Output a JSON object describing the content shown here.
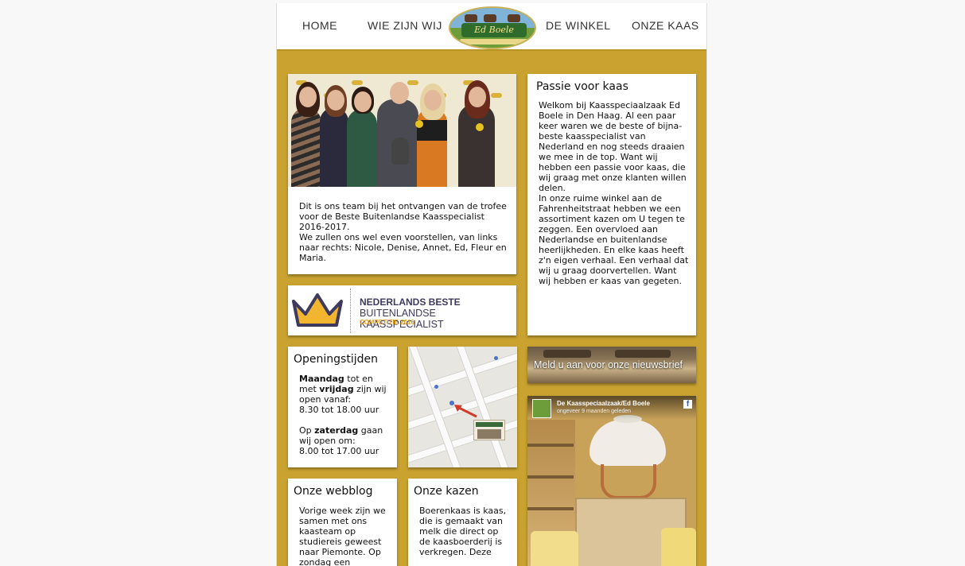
{
  "nav": {
    "home": "HOME",
    "about": "WIE ZIJN WIJ",
    "shop": "DE WINKEL",
    "cheese": "ONZE KAAS",
    "logo_text": "Ed Boele"
  },
  "team": {
    "caption_line1": "Dit is ons team bij het ontvangen van de trofee voor de Beste Buitenlandse Kaasspecialist 2016-2017.",
    "caption_line2": "We zullen ons wel even voorstellen, van links naar rechts: Nicole, Denise, Annet, Ed, Fleur en Maria."
  },
  "award": {
    "line1": "NEDERLANDS BESTE",
    "line2": "BUITENLANDSE KAASSPECIALIST",
    "line3": "COMPETITIE 2016"
  },
  "passie": {
    "title": "Passie voor kaas",
    "para1": "Welkom bij Kaasspeciaalzaak Ed Boele in Den Haag. Al een paar keer waren we de beste of bijna-beste kaasspecialist van Nederland en nog steeds draaien we mee in de top. Want wij hebben een passie voor kaas, die wij graag met onze klanten willen delen.",
    "para2": "In onze ruime winkel aan de Fahrenheitstraat hebben we een assortiment kazen om U tegen te zeggen. Een overvloed aan Nederlandse en buitenlandse heerlijkheden. En elke kaas heeft z'n eigen verhaal. Een verhaal dat wij u graag doorvertellen. Want wij hebben er kaas van gegeten."
  },
  "hours": {
    "title": "Openingstijden",
    "weekday_1": "Maandag",
    "weekday_2": " tot en met ",
    "weekday_3": "vrijdag",
    "weekday_4": " zijn wij open vanaf:",
    "weekday_time": "8.30 tot 18.00 uur",
    "sat_1": "Op ",
    "sat_2": "zaterdag",
    "sat_3": " gaan wij open om:",
    "sat_time": "8.00 tot 17.00 uur"
  },
  "newsletter": {
    "label": "Meld u aan voor onze nieuwsbrief"
  },
  "facebook": {
    "page_name": "De Kaasspeciaalzaak/Ed Boele",
    "posted": "ongeveer 9 maanden geleden",
    "logo": "f"
  },
  "blog": {
    "title": "Onze webblog",
    "text": "Vorige week zijn we samen met ons kaasteam op studiereis geweest naar Piemonte. Op zondag een"
  },
  "kazen": {
    "title": "Onze kazen",
    "text": "Boerenkaas is kaas, die is gemaakt van melk die direct op de kaasboerderij is verkregen. Deze"
  },
  "colors": {
    "page_bg": "#c9a230",
    "card_bg": "#ffffff",
    "award_purple": "#3e3a5e",
    "award_orange": "#e7a21c"
  }
}
